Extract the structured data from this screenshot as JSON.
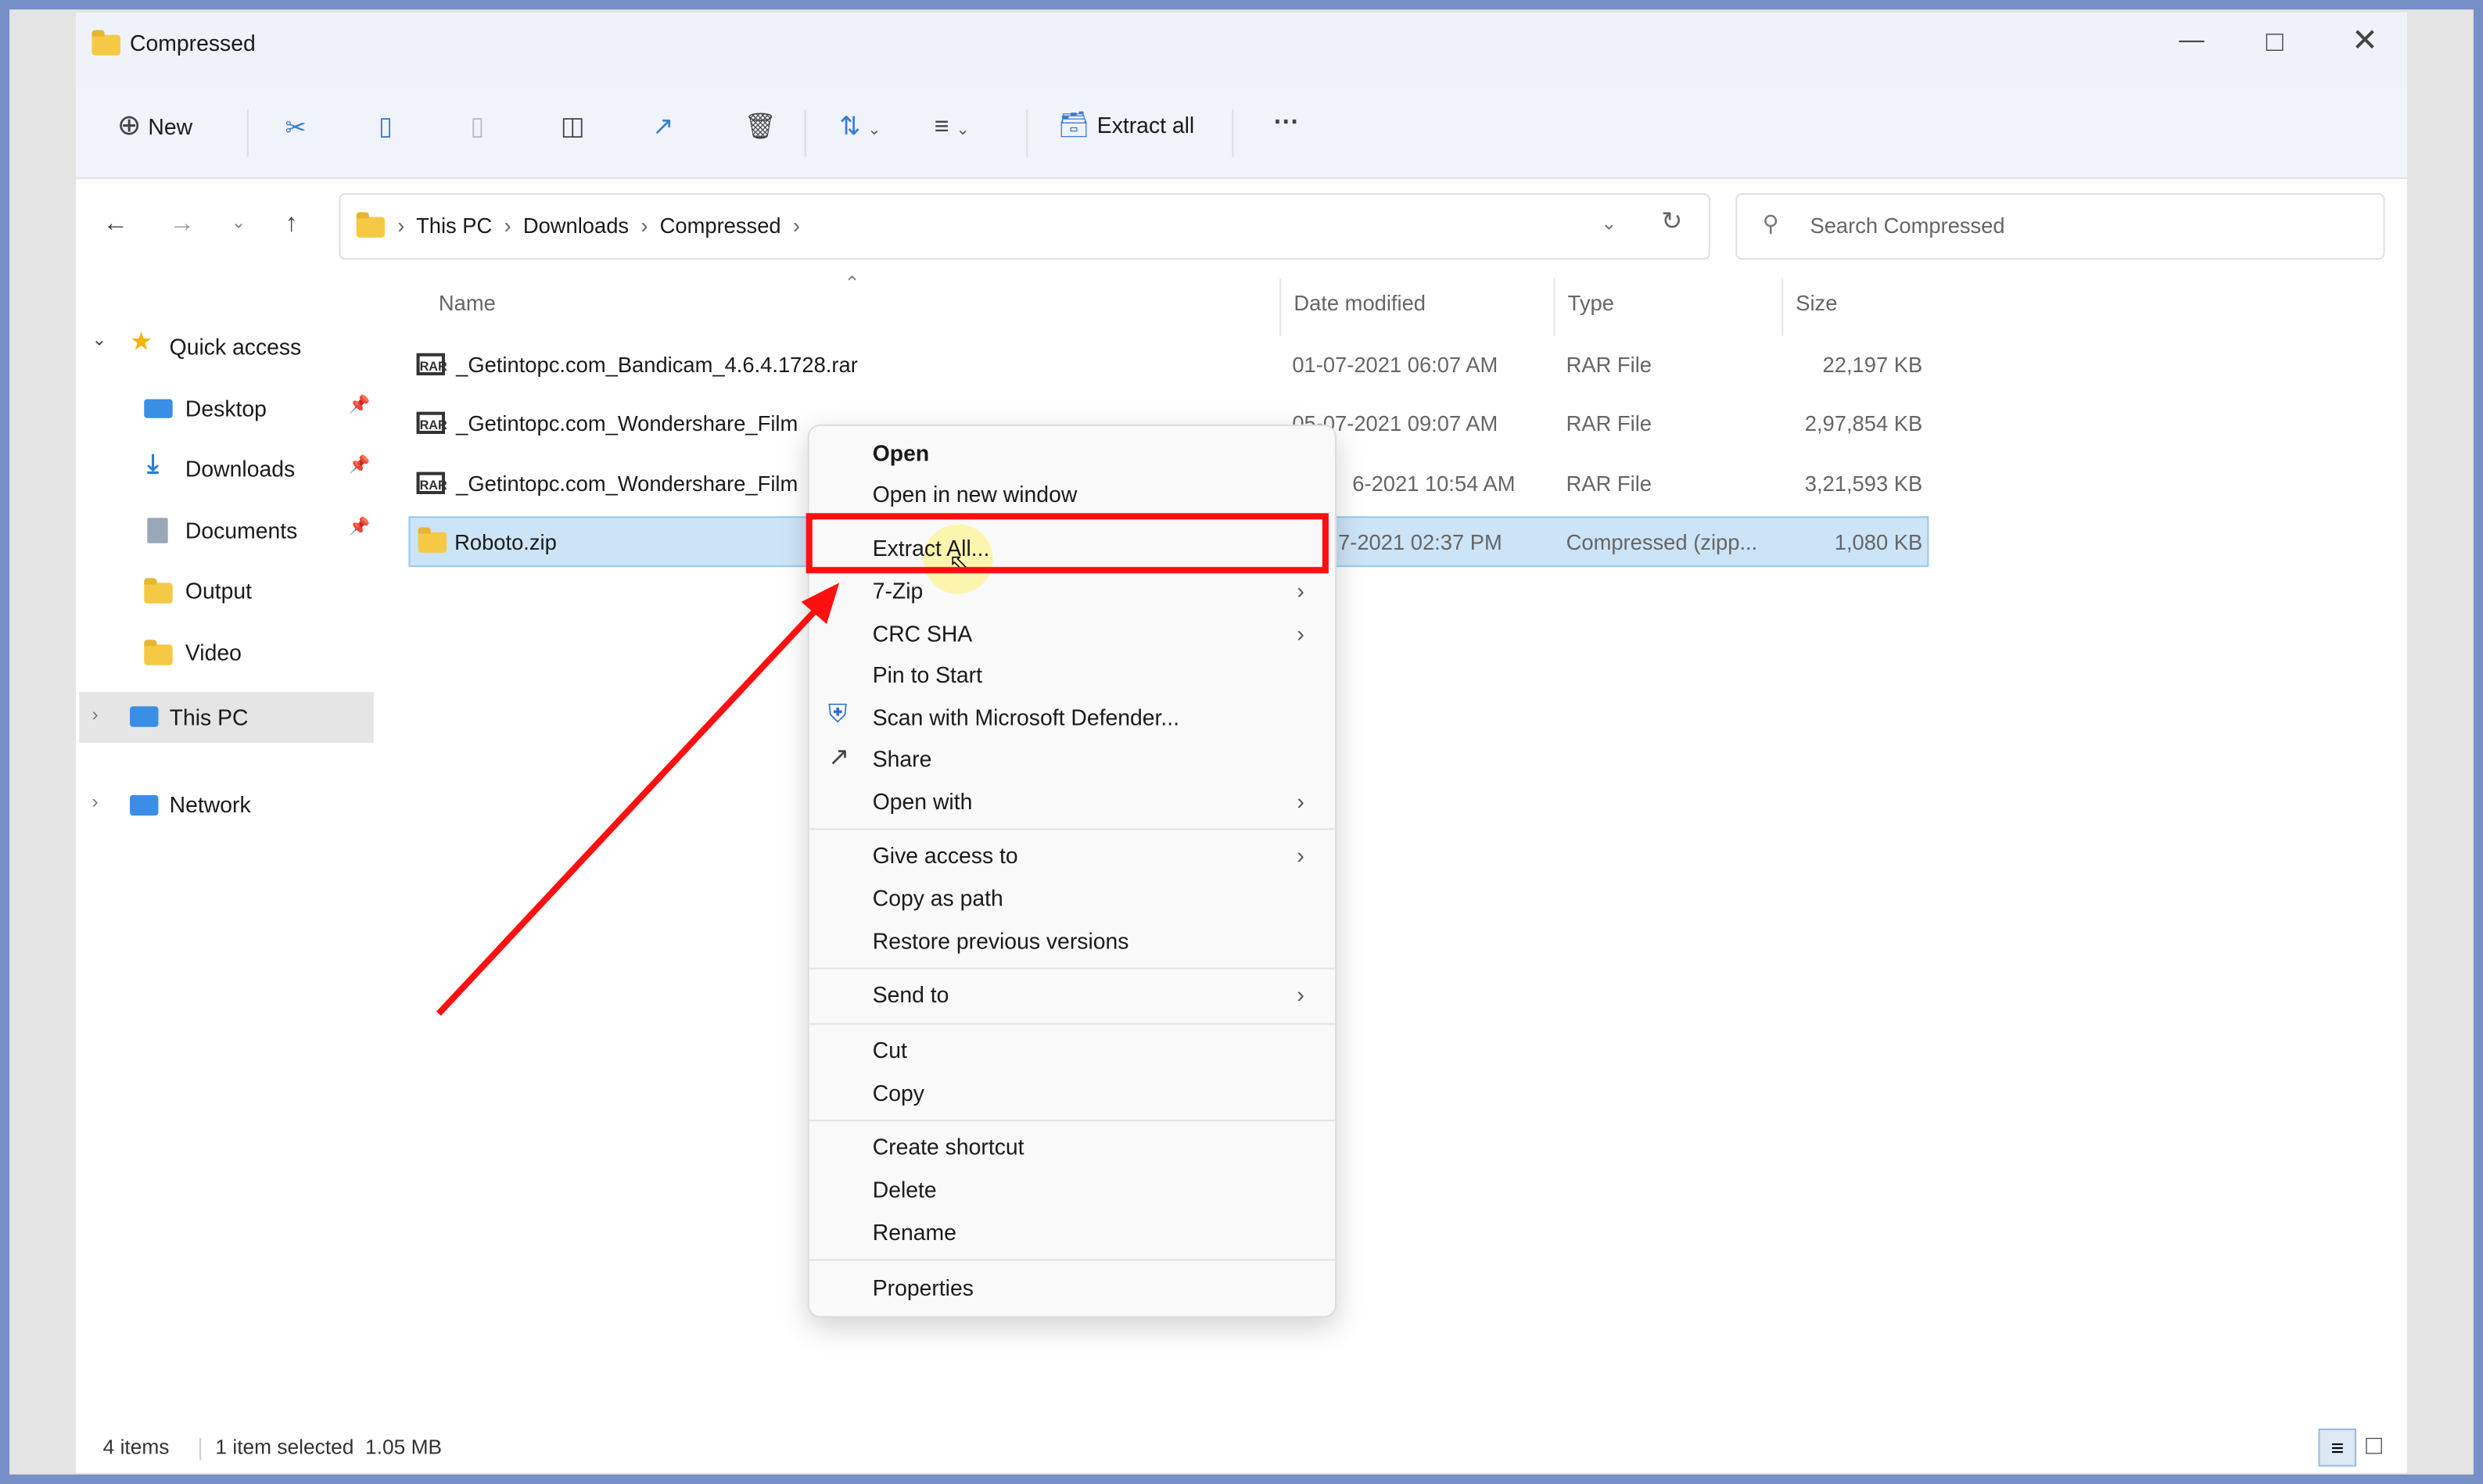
{
  "window": {
    "title": "Compressed",
    "controls": [
      "minimize",
      "maximize",
      "close"
    ]
  },
  "toolbar": {
    "new_label": "New",
    "extract_all_label": "Extract all",
    "icons": [
      "cut-icon",
      "copy-icon",
      "paste-icon",
      "rename-icon",
      "share-icon",
      "delete-icon",
      "sort-icon",
      "view-icon",
      "more-icon"
    ]
  },
  "address": {
    "breadcrumb": [
      "This PC",
      "Downloads",
      "Compressed"
    ],
    "search_placeholder": "Search Compressed"
  },
  "sidebar": {
    "items": [
      {
        "label": "Quick access",
        "icon": "star-icon"
      },
      {
        "label": "Desktop",
        "icon": "desktop-icon",
        "pinned": true
      },
      {
        "label": "Downloads",
        "icon": "download-icon",
        "pinned": true
      },
      {
        "label": "Documents",
        "icon": "documents-icon",
        "pinned": true
      },
      {
        "label": "Output",
        "icon": "folder-icon"
      },
      {
        "label": "Video",
        "icon": "folder-icon"
      },
      {
        "label": "This PC",
        "icon": "pc-icon"
      },
      {
        "label": "Network",
        "icon": "network-icon"
      }
    ]
  },
  "columns": [
    "Name",
    "Date modified",
    "Type",
    "Size"
  ],
  "files": [
    {
      "name": "_Getintopc.com_Bandicam_4.6.4.1728.rar",
      "date": "01-07-2021 06:07 AM",
      "type": "RAR File",
      "size": "22,197 KB"
    },
    {
      "name": "_Getintopc.com_Wondershare_Film",
      "date": "05-07-2021 09:07 AM",
      "type": "RAR File",
      "size": "2,97,854 KB"
    },
    {
      "name": "_Getintopc.com_Wondershare_Film",
      "date": "6-2021 10:54 AM",
      "type": "RAR File",
      "size": "3,21,593 KB"
    },
    {
      "name": "Roboto.zip",
      "date": "7-2021 02:37 PM",
      "type": "Compressed (zipp...",
      "size": "1,080 KB"
    }
  ],
  "context_menu": {
    "items": [
      "Open",
      "Open in new window",
      "Extract All...",
      "7-Zip",
      "CRC SHA",
      "Pin to Start",
      "Scan with Microsoft Defender...",
      "Share",
      "Open with",
      "Give access to",
      "Copy as path",
      "Restore previous versions",
      "Send to",
      "Cut",
      "Copy",
      "Create shortcut",
      "Delete",
      "Rename",
      "Properties"
    ]
  },
  "status": {
    "count": "4 items",
    "selection": "1 item selected  1.05 MB"
  },
  "colors": {
    "highlight": "#ff1010",
    "selection": "#cce4f7",
    "frame": "#7890c8"
  }
}
